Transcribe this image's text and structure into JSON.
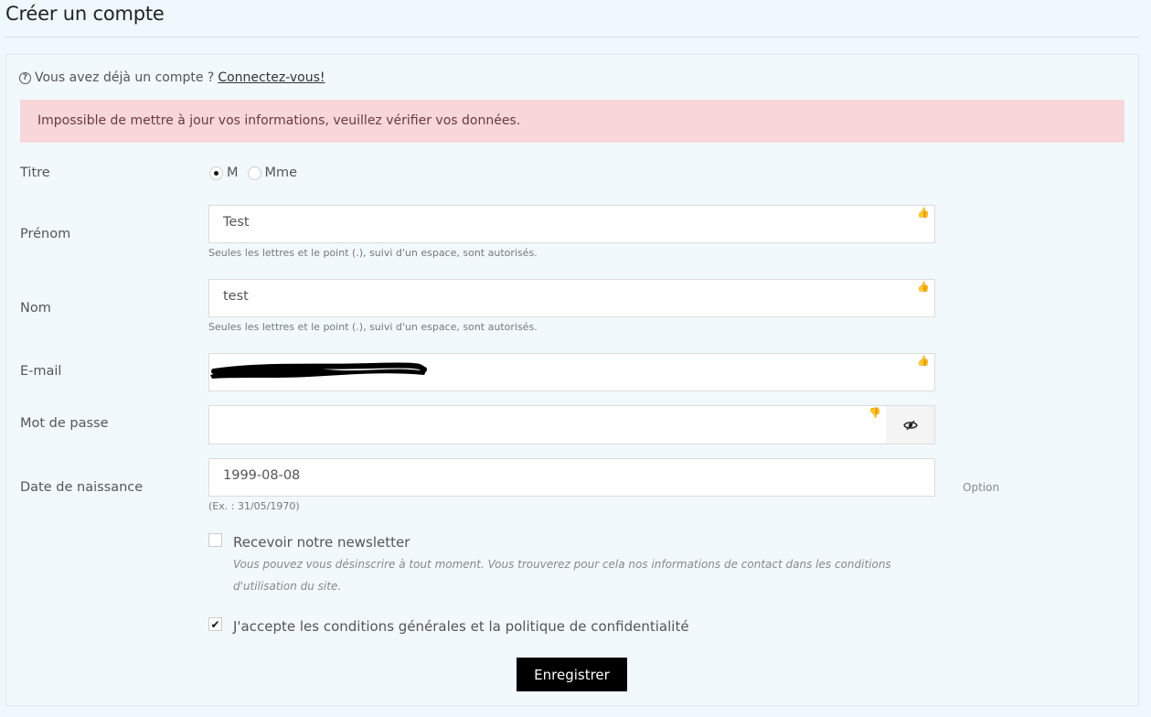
{
  "page": {
    "title": "Créer un compte"
  },
  "login": {
    "prompt": "Vous avez déjà un compte ?",
    "link": "Connectez-vous!"
  },
  "alert": {
    "message": "Impossible de mettre à jour vos informations, veuillez vérifier vos données."
  },
  "fields": {
    "title": {
      "label": "Titre",
      "options": [
        "M",
        "Mme"
      ],
      "selected": "M"
    },
    "first_name": {
      "label": "Prénom",
      "value": "Test",
      "help": "Seules les lettres et le point (.), suivi d'un espace, sont autorisés.",
      "status_icon": "thumbs-up-icon"
    },
    "last_name": {
      "label": "Nom",
      "value": "test",
      "help": "Seules les lettres et le point (.), suivi d'un espace, sont autorisés.",
      "status_icon": "thumbs-up-icon"
    },
    "email": {
      "label": "E-mail",
      "value": "",
      "status_icon": "thumbs-up-icon"
    },
    "password": {
      "label": "Mot de passe",
      "value": "",
      "status_icon": "thumbs-down-icon",
      "toggle_icon": "eye-slash-icon"
    },
    "birthday": {
      "label": "Date de naissance",
      "value": "1999-08-08",
      "help": "(Ex. : 31/05/1970)",
      "optional": "Option"
    }
  },
  "newsletter": {
    "label": "Recevoir notre newsletter",
    "note": "Vous pouvez vous désinscrire à tout moment. Vous trouverez pour cela nos informations de contact dans les conditions d'utilisation du site.",
    "checked": false
  },
  "terms": {
    "label": "J'accepte les conditions générales et la politique de confidentialité",
    "checked": true
  },
  "submit": {
    "label": "Enregistrer"
  },
  "colors": {
    "background": "#eff8fc",
    "alert_bg": "#f8d7da",
    "alert_text": "#6a3a3d",
    "button_bg": "#000000",
    "valid": "#6cbf6c",
    "invalid": "#e57c7c"
  }
}
